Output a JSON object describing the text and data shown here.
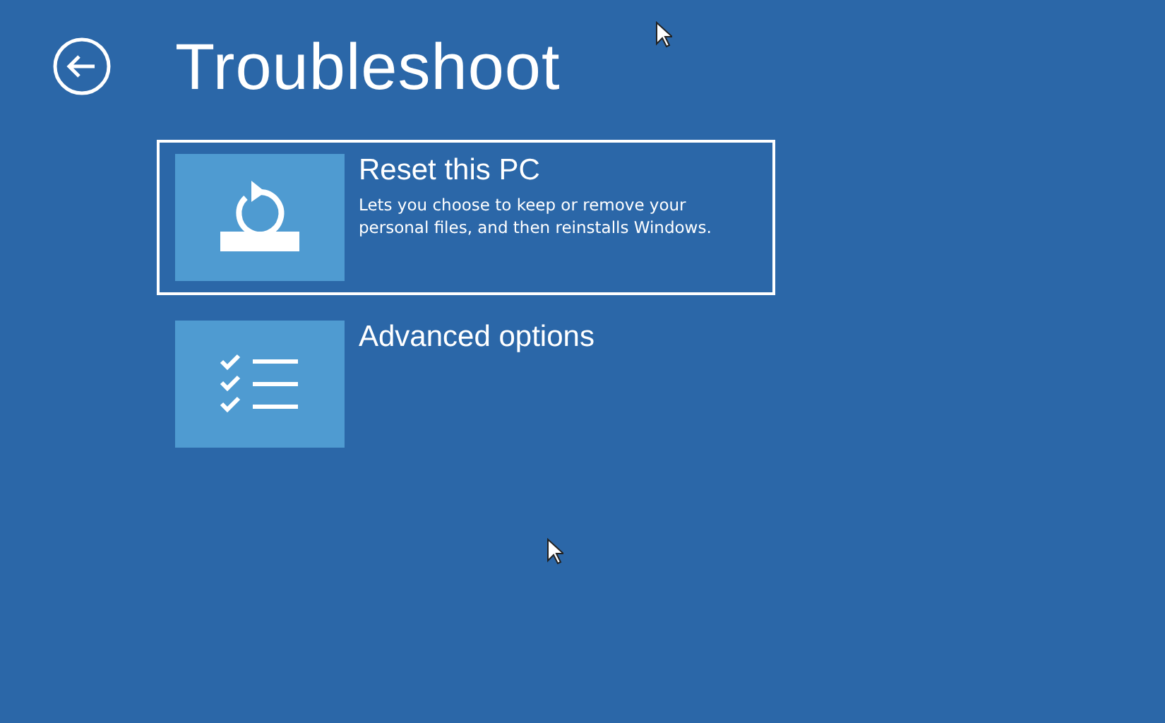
{
  "screen": {
    "title": "Troubleshoot"
  },
  "options": [
    {
      "kind": "reset",
      "title": "Reset this PC",
      "description": "Lets you choose to keep or remove your personal files, and then reinstalls Windows.",
      "selected": true
    },
    {
      "kind": "advanced",
      "title": "Advanced options",
      "selected": false
    }
  ]
}
